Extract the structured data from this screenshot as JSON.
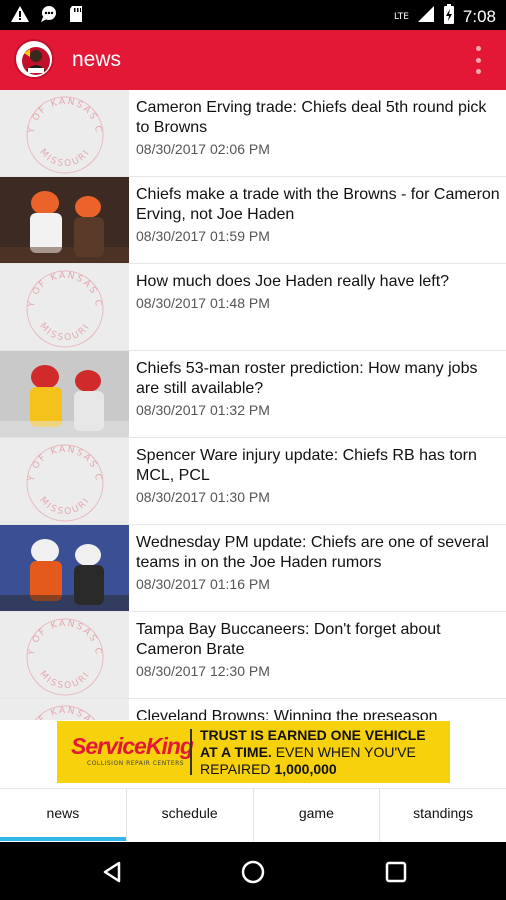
{
  "status_bar": {
    "time": "7:08",
    "network": "LTE",
    "left_icons": [
      "warning-icon",
      "chat-icon",
      "sd-card-icon"
    ],
    "right_icons": [
      "signal-icon",
      "battery-icon"
    ]
  },
  "app_bar": {
    "title": "news",
    "logo": "team-logo",
    "menu_icon": "overflow-menu-icon",
    "color": "#e31837"
  },
  "news": [
    {
      "headline": "Cameron Erving trade: Chiefs deal 5th round pick to Browns",
      "time": "08/30/2017 02:06 PM",
      "thumb": "city-seal"
    },
    {
      "headline": "Chiefs make a trade with the Browns - for Cameron Erving, not Joe Haden",
      "time": "08/30/2017 01:59 PM",
      "thumb": "photo"
    },
    {
      "headline": "How much does Joe Haden really have left?",
      "time": "08/30/2017 01:48 PM",
      "thumb": "city-seal"
    },
    {
      "headline": "Chiefs 53-man roster prediction: How many jobs are still available?",
      "time": "08/30/2017 01:32 PM",
      "thumb": "photo"
    },
    {
      "headline": "Spencer Ware injury update: Chiefs RB has torn MCL, PCL",
      "time": "08/30/2017 01:30 PM",
      "thumb": "city-seal"
    },
    {
      "headline": "Wednesday PM update: Chiefs are one of several teams in on the Joe Haden rumors",
      "time": "08/30/2017 01:16 PM",
      "thumb": "photo"
    },
    {
      "headline": "Tampa Bay Buccaneers: Don't forget about Cameron Brate",
      "time": "08/30/2017 12:30 PM",
      "thumb": "city-seal"
    },
    {
      "headline": "Cleveland Browns: Winning the preseason",
      "time": "",
      "thumb": "city-seal"
    }
  ],
  "seal": {
    "top_text": "CITY OF KANSAS CITY",
    "bottom_text": "MISSOURI"
  },
  "ad": {
    "brand": "ServiceKing",
    "brand_sub": "COLLISION REPAIR CENTERS",
    "line1": "TRUST IS EARNED ONE VEHICLE",
    "line1b": "AT A TIME.",
    "line2": "EVEN WHEN YOU'VE",
    "line3": "REPAIRED",
    "line3b": "1,000,000",
    "background": "#f6d10c"
  },
  "tabs": [
    {
      "label": "news",
      "active": true
    },
    {
      "label": "schedule",
      "active": false
    },
    {
      "label": "game",
      "active": false
    },
    {
      "label": "standings",
      "active": false
    }
  ],
  "nav_bar": {
    "buttons": [
      "back-icon",
      "home-icon",
      "recents-icon"
    ]
  },
  "colors": {
    "accent": "#e31837",
    "tab_indicator": "#33b5e5"
  }
}
